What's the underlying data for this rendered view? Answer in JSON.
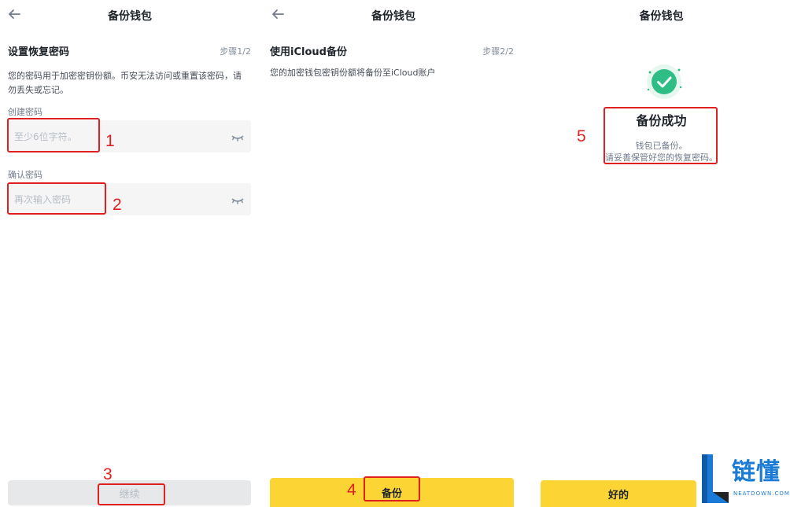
{
  "panel1": {
    "title": "备份钱包",
    "section_title": "设置恢复密码",
    "step": "步骤1/2",
    "description_line1": "您的密码用于加密密钥份额。币安无法访问或重置该密码，请",
    "description_line2": "勿丢失或忘记。",
    "create_label": "创建密码",
    "create_placeholder": "至少6位字符。",
    "confirm_label": "确认密码",
    "confirm_placeholder": "再次输入密码",
    "continue_label": "继续"
  },
  "panel2": {
    "title": "备份钱包",
    "section_title": "使用iCloud备份",
    "step": "步骤2/2",
    "description": "您的加密钱包密钥份额将备份至iCloud账户",
    "backup_label": "备份"
  },
  "panel3": {
    "title": "备份钱包",
    "success_title": "备份成功",
    "success_line1": "钱包已备份。",
    "success_line2": "请妥善保管好您的恢复密码。",
    "ok_label": "好的"
  },
  "annotations": [
    "1",
    "2",
    "3",
    "4",
    "5"
  ],
  "watermark": {
    "name": "链懂",
    "domain": "NEATDOWN.COM"
  },
  "colors": {
    "accent_yellow": "#fcd535",
    "success_green": "#2ebd85",
    "annotation_red": "#e02020",
    "disabled_gray": "#e6e8ea"
  }
}
